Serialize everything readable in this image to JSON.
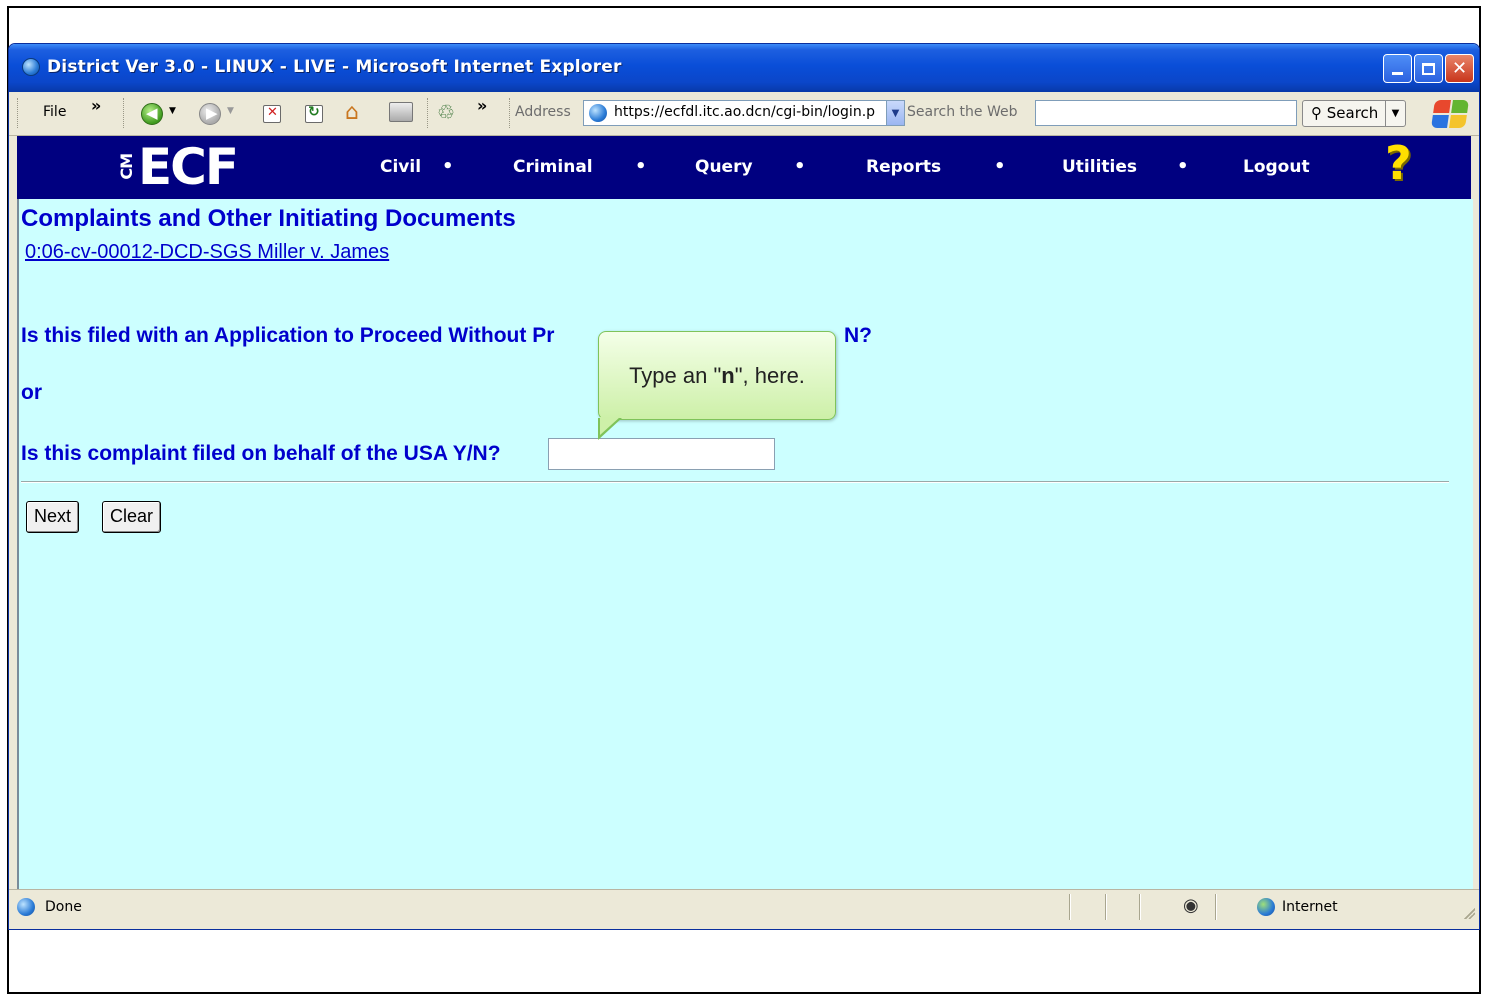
{
  "window": {
    "title": "District Ver 3.0 - LINUX - LIVE - Microsoft Internet Explorer"
  },
  "toolbar": {
    "file_label": "File",
    "chevron": "»",
    "address_label": "Address",
    "address_value": "https://ecfdl.itc.ao.dcn/cgi-bin/login.p",
    "search_web_label": "Search the Web",
    "search_button_label": "Search"
  },
  "nav": {
    "logo_cm": "CM",
    "logo_main": "ECF",
    "items": [
      {
        "label": "Civil"
      },
      {
        "label": "Criminal"
      },
      {
        "label": "Query"
      },
      {
        "label": "Reports"
      },
      {
        "label": "Utilities"
      },
      {
        "label": "Logout"
      }
    ],
    "separator": "•",
    "help_glyph": "?"
  },
  "page": {
    "title": "Complaints and Other Initiating Documents",
    "case_link": "0:06-cv-00012-DCD-SGS Miller v. James",
    "question_1_visible_start": "Is this filed with an Application to Proceed Without Pr",
    "question_1_visible_end": "N?",
    "or_text": "or",
    "question_2": "Is this complaint filed on behalf of the USA Y/N?",
    "question_2_input_value": "",
    "next_button": "Next",
    "clear_button": "Clear"
  },
  "callout": {
    "prefix": "Type an \"",
    "bold": "n",
    "suffix": "\", here."
  },
  "status": {
    "text": "Done",
    "zone": "Internet"
  }
}
